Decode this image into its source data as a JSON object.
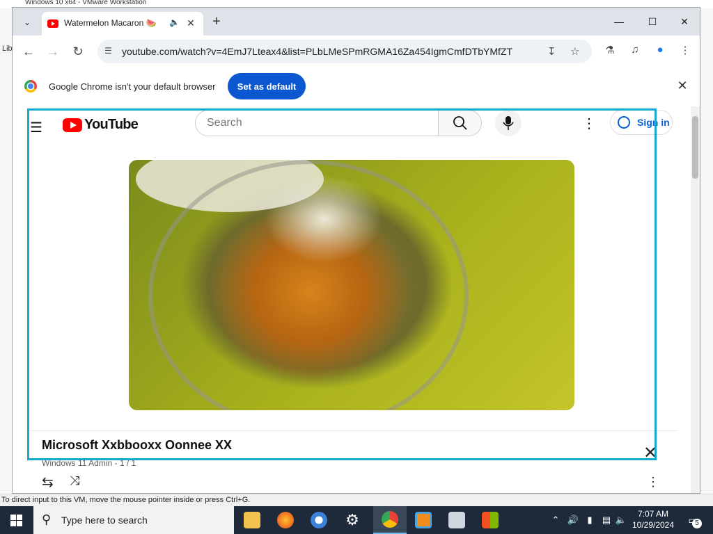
{
  "vm": {
    "title": "Windows 10 x64 - VMware Workstation",
    "left_label": "Lib",
    "status_text": "To direct input to this VM, move the mouse pointer inside or press Ctrl+G."
  },
  "browser": {
    "tab_title": "Watermelon Macaron 🍉",
    "new_tab": "+",
    "url": "youtube.com/watch?v=4EmJ7Lteax4&list=PLbLMeSPmRGMA16Za454IgmCmfDTbYMfZT",
    "infobar": {
      "message": "Google Chrome isn't your default browser",
      "button": "Set as default"
    }
  },
  "youtube": {
    "logo_text": "YouTube",
    "search_placeholder": "Search",
    "sign_in": "Sign in",
    "playlist": {
      "title": "Microsoft Xxbbooxx Oonnee XX",
      "subtitle": "Windows 11 Admin - 1 / 1"
    }
  },
  "taskbar": {
    "search_placeholder": "Type here to search",
    "time": "7:07 AM",
    "date": "10/29/2024",
    "notification_count": "5",
    "apps": [
      "file-explorer",
      "firefox",
      "chromium",
      "settings",
      "chrome",
      "vmware",
      "network-app",
      "store"
    ]
  },
  "colors": {
    "accent_blue": "#0b57d0",
    "youtube_red": "#ff0000",
    "highlight": "#14a9d0",
    "taskbar": "#1e2a3a"
  }
}
